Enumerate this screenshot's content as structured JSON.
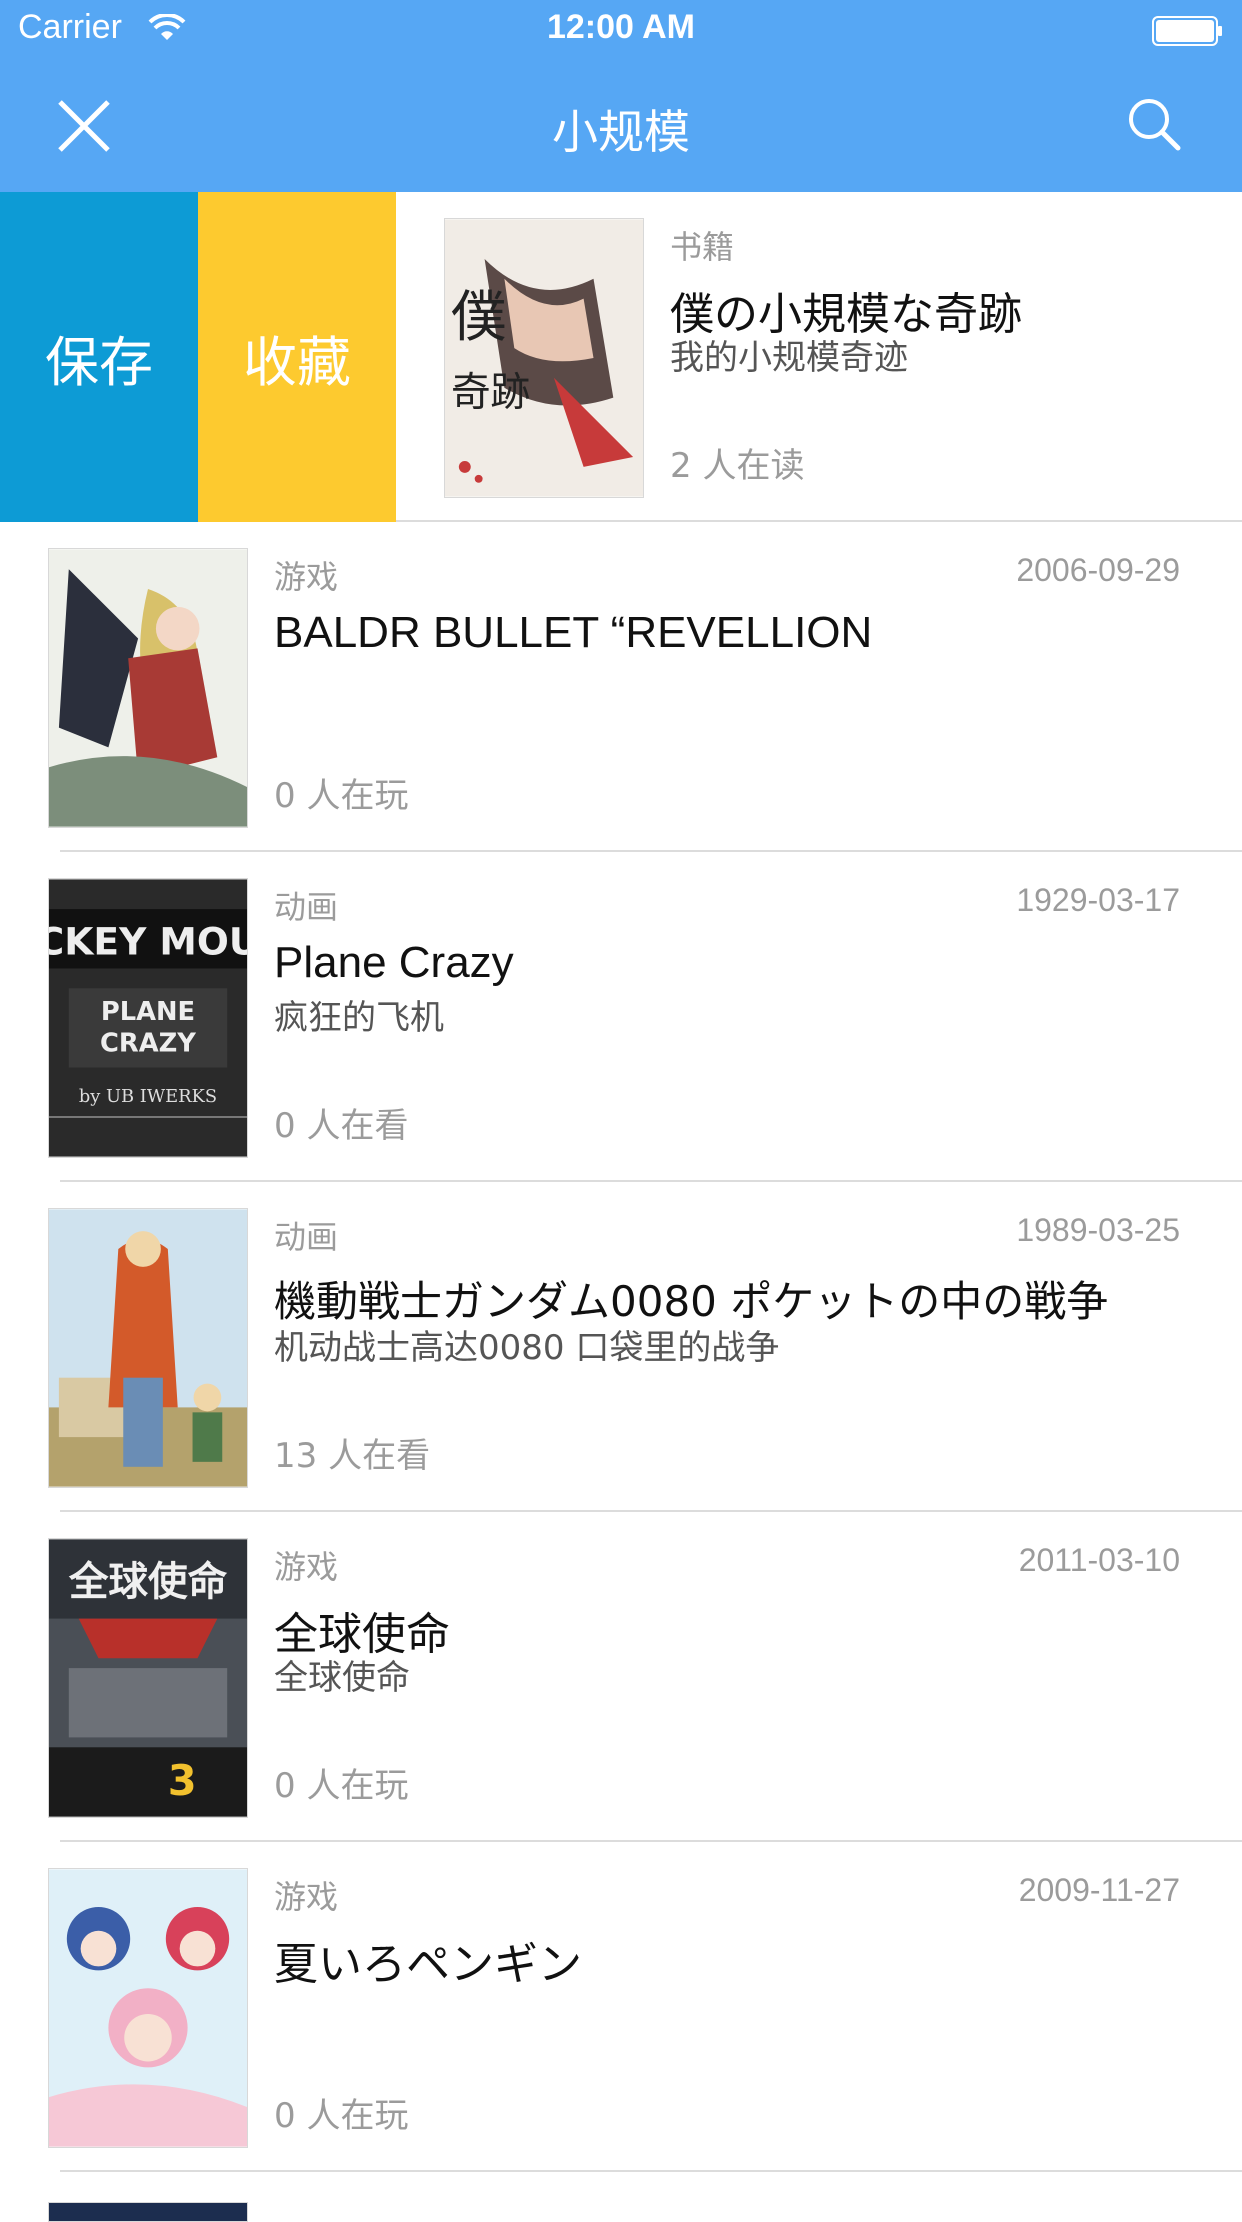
{
  "status": {
    "carrier": "Carrier",
    "time": "12:00 AM"
  },
  "nav": {
    "title": "小规模"
  },
  "swipe_actions": {
    "save": "保存",
    "favorite": "收藏"
  },
  "items": [
    {
      "type": "书籍",
      "date": "",
      "title": "僕の小規模な奇跡",
      "subtitle": "我的小规模奇迹",
      "count": "2 人在读"
    },
    {
      "type": "游戏",
      "date": "2006-09-29",
      "title": "BALDR BULLET “REVELLION",
      "subtitle": "",
      "count": "0 人在玩"
    },
    {
      "type": "动画",
      "date": "1929-03-17",
      "title": "Plane Crazy",
      "subtitle": "疯狂的飞机",
      "count": "0 人在看"
    },
    {
      "type": "动画",
      "date": "1989-03-25",
      "title": "機動戦士ガンダム0080 ポケットの中の戦争",
      "subtitle": "机动战士高达0080 口袋里的战争",
      "count": "13 人在看"
    },
    {
      "type": "游戏",
      "date": "2011-03-10",
      "title": "全球使命",
      "subtitle": "全球使命",
      "count": "0 人在玩"
    },
    {
      "type": "游戏",
      "date": "2009-11-27",
      "title": "夏いろペンギン",
      "subtitle": "",
      "count": "0 人在玩"
    }
  ],
  "covers": {
    "cover0": {
      "text_a": "僕",
      "text_b": "奇跡"
    },
    "cover2": {
      "line1": "CKEY MOU",
      "line2": "PLANE",
      "line3": "CRAZY",
      "line4": "by UB IWERKS"
    },
    "cover4": {
      "line1": "全球使命",
      "line2": "3"
    }
  }
}
